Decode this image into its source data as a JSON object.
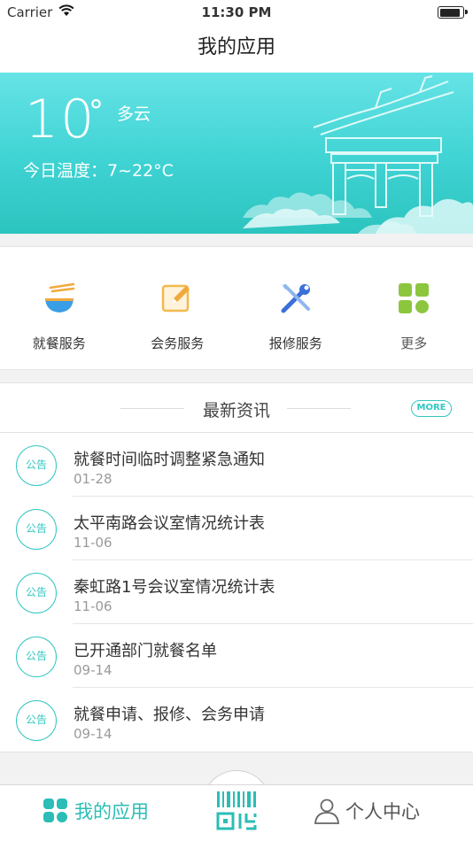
{
  "status_bar": {
    "carrier": "Carrier",
    "time": "11:30 PM",
    "battery_level": 0.9
  },
  "nav": {
    "title": "我的应用"
  },
  "weather": {
    "temperature": "10",
    "degree_symbol": "°",
    "condition": "多云",
    "range_text": "今日温度：7~22°C"
  },
  "services": [
    {
      "label": "就餐服务",
      "icon": "noodle-bowl-icon"
    },
    {
      "label": "会务服务",
      "icon": "pencil-note-icon"
    },
    {
      "label": "报修服务",
      "icon": "wrench-screwdriver-icon"
    },
    {
      "label": "更多",
      "icon": "grid-more-icon"
    }
  ],
  "news": {
    "title": "最新资讯",
    "more_label": "MORE",
    "badge_label": "公告",
    "items": [
      {
        "title": "就餐时间临时调整紧急通知",
        "date": "01-28"
      },
      {
        "title": "太平南路会议室情况统计表",
        "date": "11-06"
      },
      {
        "title": "秦虹路1号会议室情况统计表",
        "date": "11-06"
      },
      {
        "title": "已开通部门就餐名单",
        "date": "09-14"
      },
      {
        "title": "就餐申请、报修、会务申请",
        "date": "09-14"
      }
    ]
  },
  "tabs": {
    "apps_label": "我的应用",
    "me_label": "个人中心"
  },
  "colors": {
    "accent": "#34c7c2",
    "banner_top": "#66e3e6",
    "banner_bottom": "#2cc4bf"
  }
}
